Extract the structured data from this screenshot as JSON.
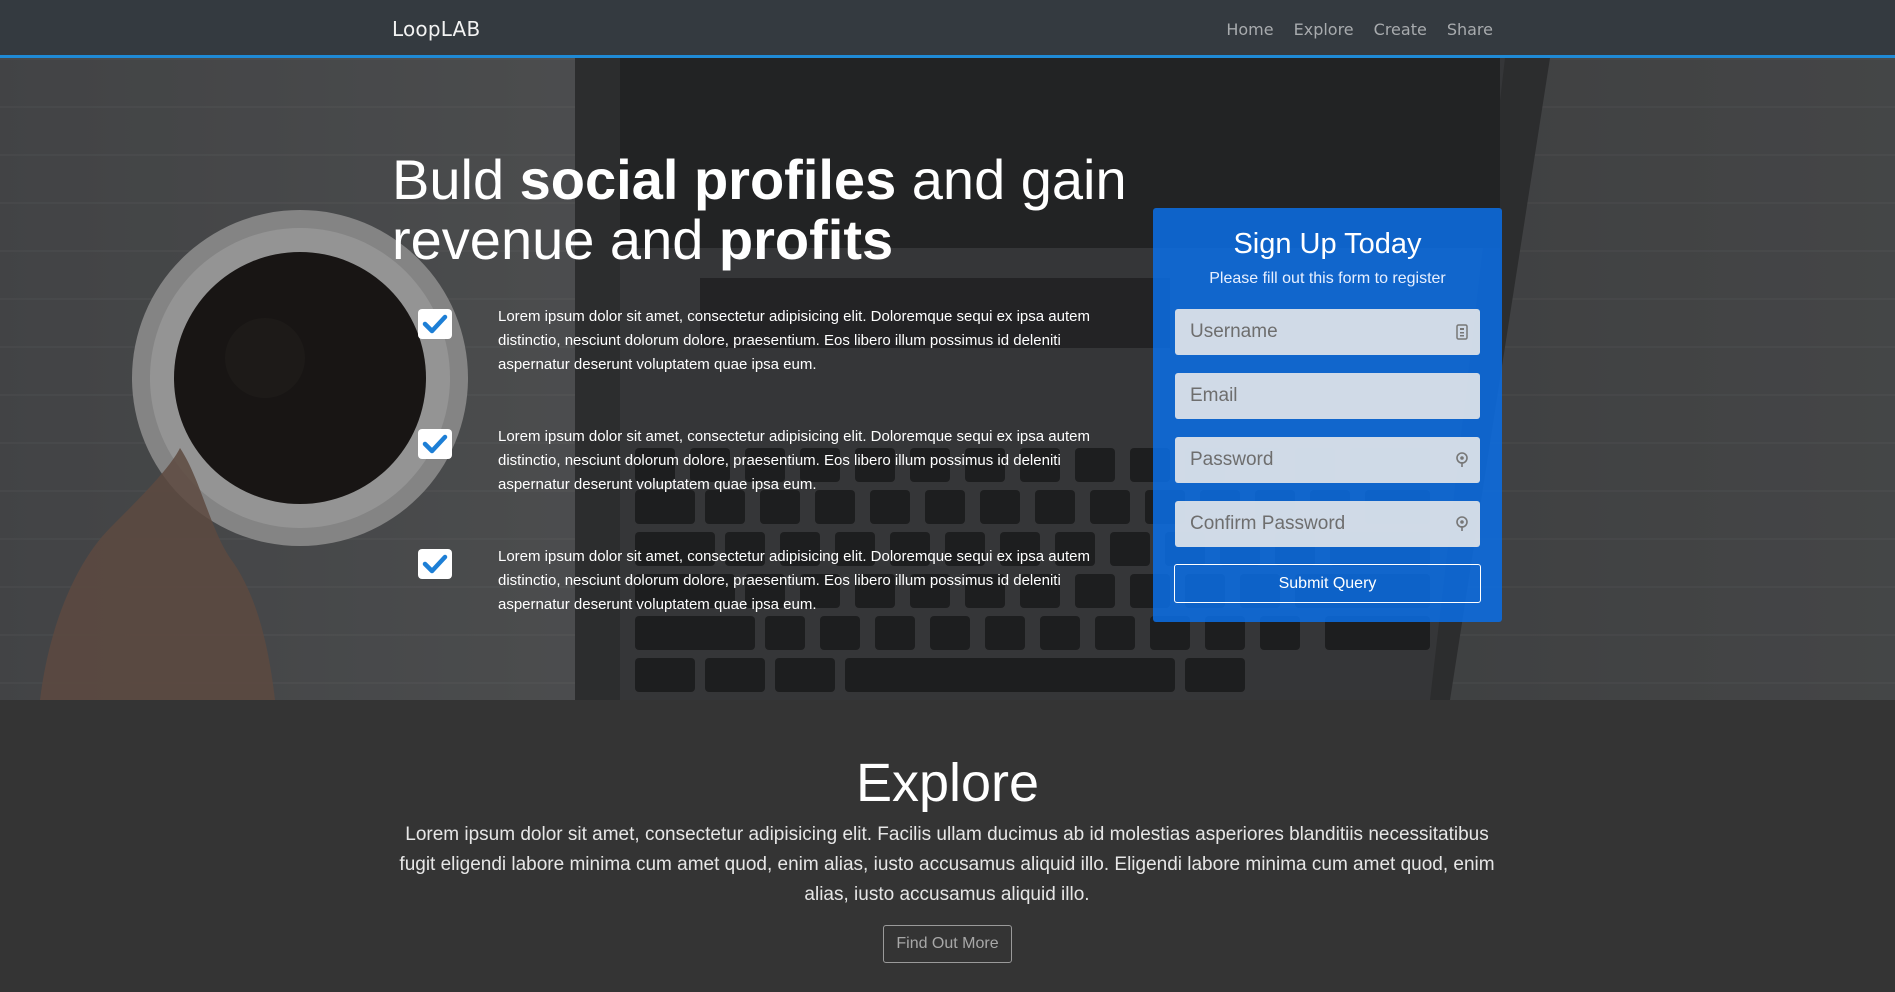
{
  "navbar": {
    "brand": "LoopLAB",
    "links": [
      "Home",
      "Explore",
      "Create",
      "Share"
    ]
  },
  "hero": {
    "title": {
      "part1": "Buld ",
      "bold1": "social profiles",
      "part2": " and gain revenue and ",
      "bold2": "profits"
    },
    "features": [
      "Lorem ipsum dolor sit amet, consectetur adipisicing elit. Doloremque sequi ex ipsa autem distinctio, nesciunt dolorum dolore, praesentium. Eos libero illum possimus id deleniti aspernatur deserunt voluptatem quae ipsa eum.",
      "Lorem ipsum dolor sit amet, consectetur adipisicing elit. Doloremque sequi ex ipsa autem distinctio, nesciunt dolorum dolore, praesentium. Eos libero illum possimus id deleniti aspernatur deserunt voluptatem quae ipsa eum.",
      "Lorem ipsum dolor sit amet, consectetur adipisicing elit. Doloremque sequi ex ipsa autem distinctio, nesciunt dolorum dolore, praesentium. Eos libero illum possimus id deleniti aspernatur deserunt voluptatem quae ipsa eum."
    ],
    "check_icon": "check-icon"
  },
  "signup": {
    "title": "Sign Up Today",
    "subtitle": "Please fill out this form to register",
    "fields": {
      "username": {
        "placeholder": "Username",
        "value": "",
        "icon": "id-card-icon"
      },
      "email": {
        "placeholder": "Email",
        "value": ""
      },
      "password": {
        "placeholder": "Password",
        "value": "",
        "icon": "key-icon"
      },
      "confirm_password": {
        "placeholder": "Confirm Password",
        "value": "",
        "icon": "key-icon"
      }
    },
    "submit_label": "Submit Query",
    "accent_color": "#0a6ee6"
  },
  "explore": {
    "title": "Explore",
    "text": "Lorem ipsum dolor sit amet, consectetur adipisicing elit. Facilis ullam ducimus ab id molestias asperiores blanditiis necessitatibus fugit eligendi labore minima cum amet quod, enim alias, iusto accusamus aliquid illo. Eligendi labore minima cum amet quod, enim alias, iusto accusamus aliquid illo.",
    "button_label": "Find Out More"
  },
  "colors": {
    "navbar_bg": "#343a40",
    "navbar_border": "#1f8ad6",
    "explore_bg": "#343434"
  }
}
